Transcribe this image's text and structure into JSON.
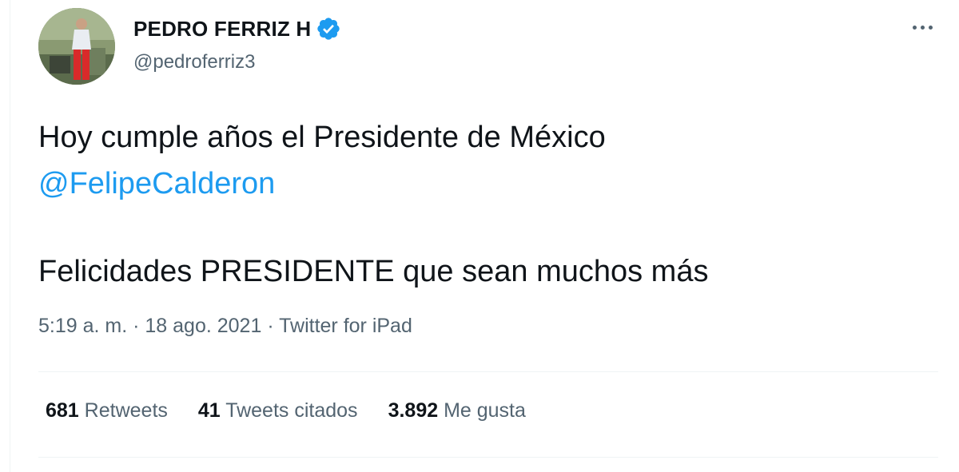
{
  "author": {
    "display_name": "PEDRO FERRIZ H",
    "handle": "@pedroferriz3",
    "verified": true,
    "avatar_icon": "avatar-photo-icon"
  },
  "menu": {
    "icon": "more-options-icon"
  },
  "tweet": {
    "line1": "Hoy cumple años el Presidente de México",
    "mention": "@FelipeCalderon",
    "line3": "Felicidades PRESIDENTE que sean muchos más"
  },
  "meta": {
    "time": "5:19 a. m.",
    "sep1": " · ",
    "date": "18 ago. 2021",
    "sep2": " · ",
    "source": "Twitter for iPad"
  },
  "stats": {
    "retweets_count": "681",
    "retweets_label": "Retweets",
    "quotes_count": "41",
    "quotes_label": "Tweets citados",
    "likes_count": "3.892",
    "likes_label": "Me gusta"
  },
  "colors": {
    "accent": "#1d9bf0",
    "text": "#0f1419",
    "secondary": "#536471",
    "divider": "#eff3f4"
  }
}
